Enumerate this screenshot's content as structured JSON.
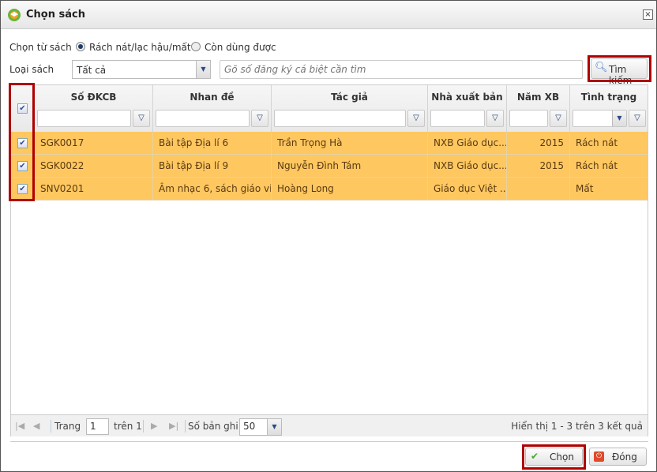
{
  "window": {
    "title": "Chọn sách",
    "close_label": "×"
  },
  "filters": {
    "source_label": "Chọn từ sách",
    "radio_options": [
      {
        "label": "Rách nát/lạc hậu/mất",
        "selected": true
      },
      {
        "label": "Còn dùng được",
        "selected": false
      }
    ],
    "type_label": "Loại sách",
    "type_value": "Tất cả",
    "search_placeholder": "Gõ số đăng ký cá biệt cần tìm",
    "search_button": "Tìm kiếm"
  },
  "grid": {
    "columns": [
      "Số ĐKCB",
      "Nhan đề",
      "Tác giả",
      "Nhà xuất bản",
      "Năm XB",
      "Tình trạng"
    ],
    "rows": [
      {
        "checked": true,
        "code": "SGK0017",
        "title": "Bài tập Địa lí 6",
        "author": "Trần Trọng Hà",
        "publisher": "NXB Giáo dục...",
        "year": "2015",
        "status": "Rách nát"
      },
      {
        "checked": true,
        "code": "SGK0022",
        "title": "Bài tập Địa lí 9",
        "author": "Nguyễn Đình Tám",
        "publisher": "NXB Giáo dục...",
        "year": "2015",
        "status": "Rách nát"
      },
      {
        "checked": true,
        "code": "SNV0201",
        "title": "Âm nhạc 6, sách giáo vi...",
        "author": "Hoàng Long",
        "publisher": "Giáo dục Việt ...",
        "year": "",
        "status": "Mất"
      }
    ],
    "highlight_color": "#fec760"
  },
  "pager": {
    "page_label": "Trang",
    "page": "1",
    "of_label": "trên 1",
    "page_size_label": "Số bản ghi",
    "page_size": "50",
    "summary": "Hiển thị 1 - 3 trên 3 kết quả"
  },
  "footer": {
    "choose": "Chọn",
    "close": "Đóng"
  }
}
